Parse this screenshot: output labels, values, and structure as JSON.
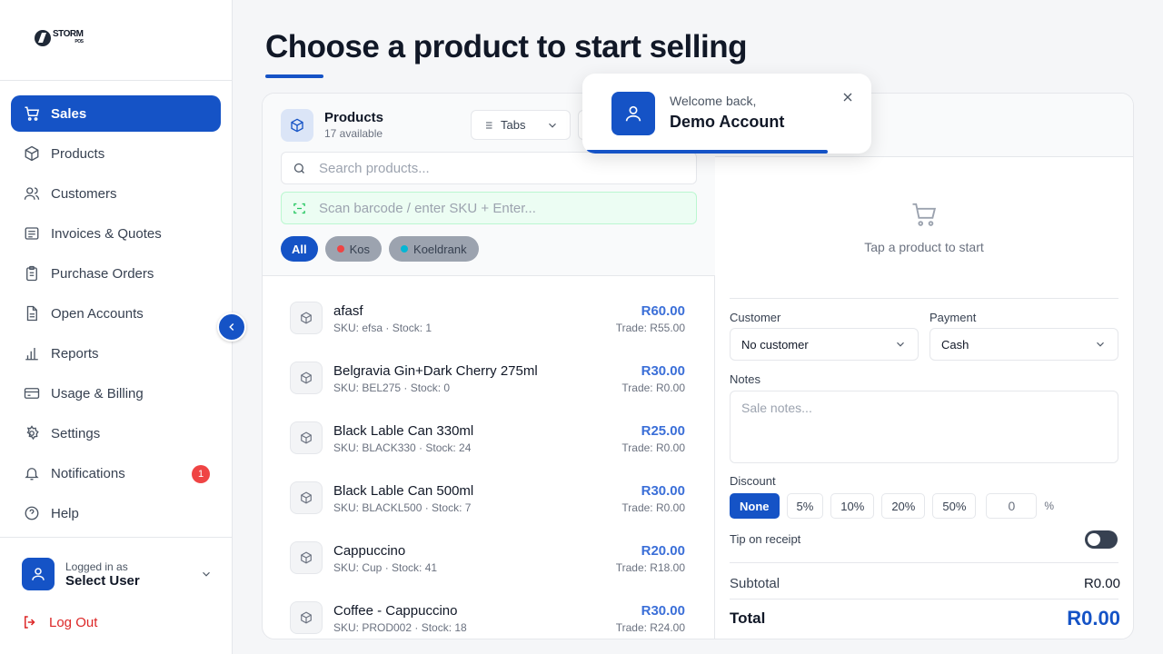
{
  "brand": {
    "name": "STORM",
    "sub": "POS"
  },
  "sidebar": {
    "items": [
      {
        "label": "Sales",
        "icon": "cart-icon"
      },
      {
        "label": "Products",
        "icon": "box-icon"
      },
      {
        "label": "Customers",
        "icon": "users-icon"
      },
      {
        "label": "Invoices & Quotes",
        "icon": "receipt-icon"
      },
      {
        "label": "Purchase Orders",
        "icon": "clipboard-icon"
      },
      {
        "label": "Open Accounts",
        "icon": "file-icon"
      },
      {
        "label": "Reports",
        "icon": "bar-chart-icon"
      },
      {
        "label": "Usage & Billing",
        "icon": "credit-card-icon"
      },
      {
        "label": "Settings",
        "icon": "gear-icon"
      },
      {
        "label": "Notifications",
        "icon": "bell-icon",
        "badge": "1"
      },
      {
        "label": "Help",
        "icon": "help-icon"
      }
    ],
    "user": {
      "prefix": "Logged in as",
      "name": "Select User"
    },
    "logout": "Log Out"
  },
  "page": {
    "title": "Choose a product to start selling"
  },
  "products": {
    "title": "Products",
    "count_text": "17 available",
    "view_select": "Tabs",
    "search_placeholder": "Search products...",
    "scan_placeholder": "Scan barcode / enter SKU + Enter...",
    "filters": [
      {
        "label": "All",
        "active": true
      },
      {
        "label": "Kos",
        "color": "#ef4444"
      },
      {
        "label": "Koeldrank",
        "color": "#06b6d4"
      }
    ],
    "items": [
      {
        "name": "afasf",
        "sku": "SKU: efsa · Stock: 1",
        "price": "R60.00",
        "trade": "Trade: R55.00"
      },
      {
        "name": "Belgravia Gin+Dark Cherry 275ml",
        "sku": "SKU: BEL275 · Stock: 0",
        "price": "R30.00",
        "trade": "Trade: R0.00"
      },
      {
        "name": "Black Lable Can 330ml",
        "sku": "SKU: BLACK330 · Stock: 24",
        "price": "R25.00",
        "trade": "Trade: R0.00"
      },
      {
        "name": "Black Lable Can 500ml",
        "sku": "SKU: BLACKL500 · Stock: 7",
        "price": "R30.00",
        "trade": "Trade: R0.00"
      },
      {
        "name": "Cappuccino",
        "sku": "SKU: Cup · Stock: 41",
        "price": "R20.00",
        "trade": "Trade: R18.00"
      },
      {
        "name": "Coffee - Cappuccino",
        "sku": "SKU: PROD002 · Stock: 18",
        "price": "R30.00",
        "trade": "Trade: R24.00"
      }
    ]
  },
  "cart": {
    "empty_text": "Tap a product to start",
    "customer_label": "Customer",
    "customer_value": "No customer",
    "payment_label": "Payment",
    "payment_value": "Cash",
    "notes_label": "Notes",
    "notes_placeholder": "Sale notes...",
    "discount_label": "Discount",
    "discounts": [
      "None",
      "5%",
      "10%",
      "20%",
      "50%"
    ],
    "discount_custom": "0",
    "discount_unit": "%",
    "tip_label": "Tip on receipt",
    "subtotal_label": "Subtotal",
    "subtotal_value": "R0.00",
    "total_label": "Total",
    "total_value": "R0.00"
  },
  "toast": {
    "line1": "Welcome back,",
    "line2": "Demo Account"
  },
  "colors": {
    "primary": "#1553c6",
    "price": "#3b6fd8",
    "danger": "#dc2626"
  }
}
